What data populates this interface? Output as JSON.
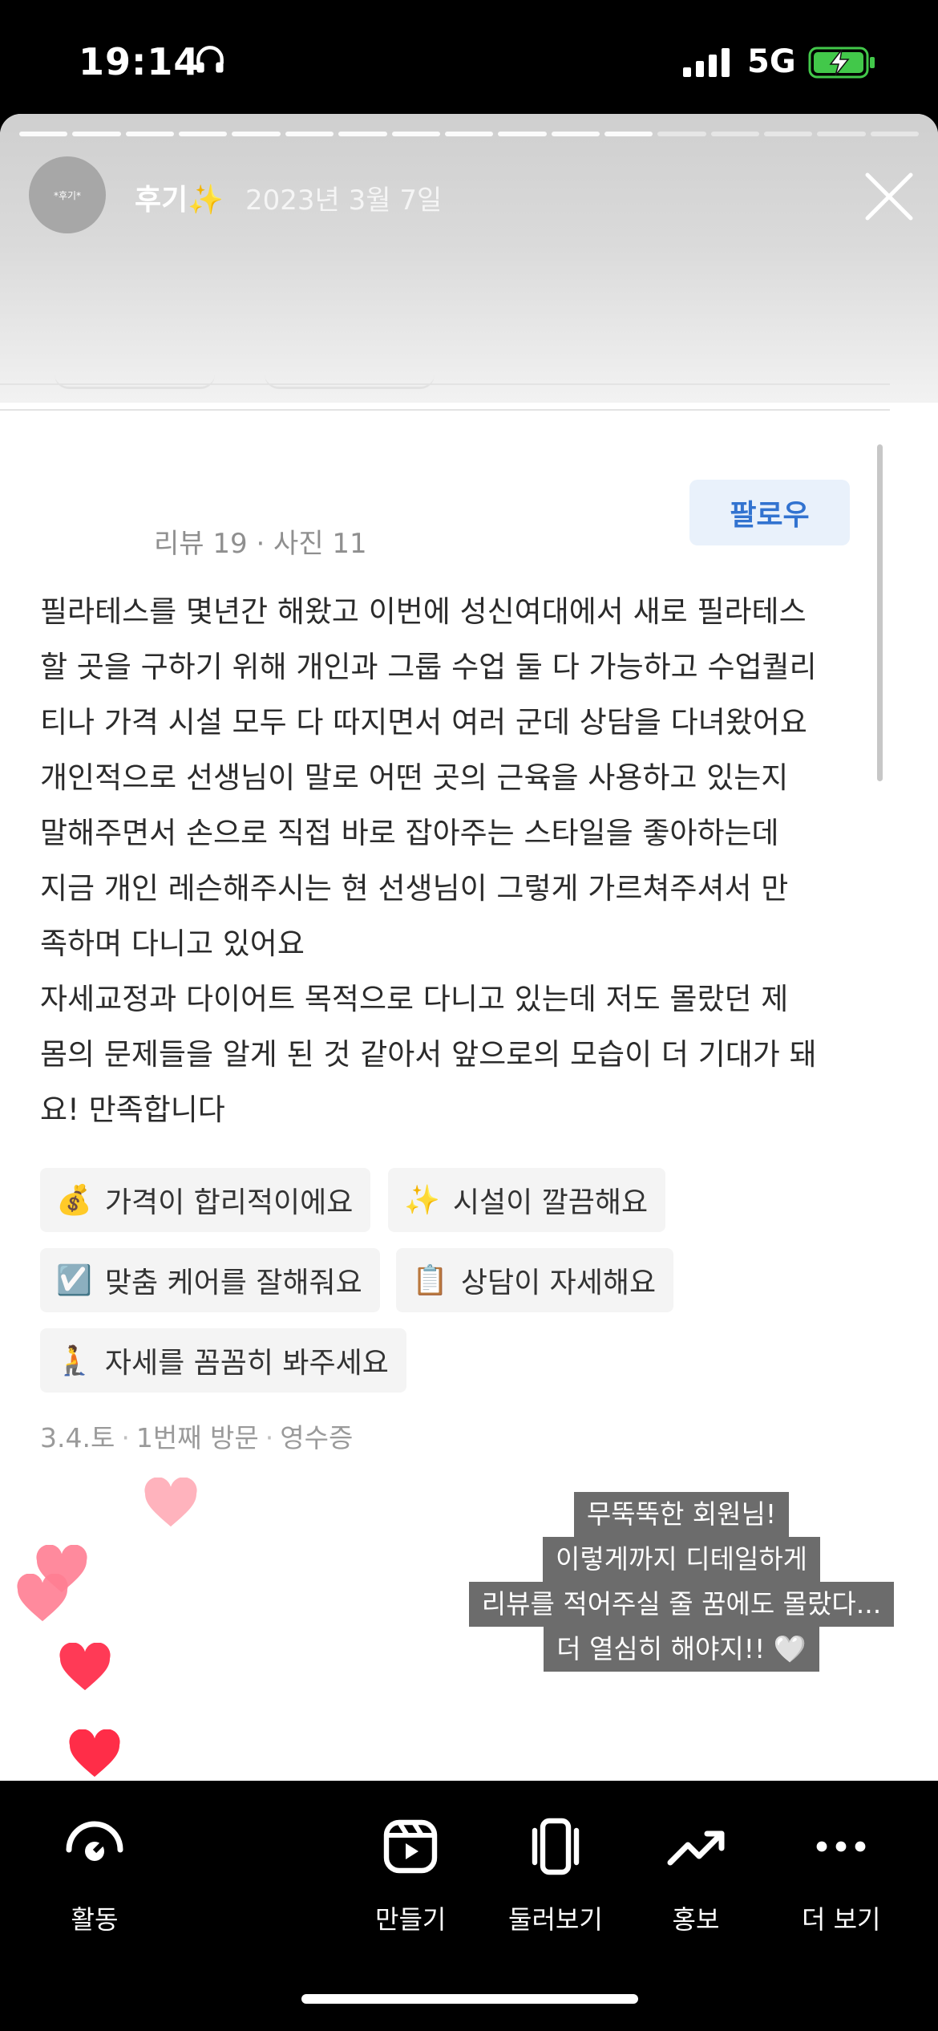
{
  "status_bar": {
    "time": "19:14",
    "network": "5G"
  },
  "story": {
    "avatar_text": "*후기*",
    "username": "후기✨",
    "date": "2023년 3월 7일"
  },
  "review": {
    "meta": "리뷰 19 · 사진 11",
    "follow_label": "팔로우",
    "lines": [
      "필라테스를 몇년간 해왔고 이번에 성신여대에서 새로 필라테스",
      "할 곳을 구하기 위해 개인과 그룹 수업 둘 다 가능하고 수업퀄리",
      "티나 가격 시설 모두 다 따지면서 여러 군데 상담을 다녀왔어요",
      "개인적으로 선생님이 말로 어떤 곳의 근육을 사용하고 있는지",
      "말해주면서 손으로 직접 바로 잡아주는 스타일을 좋아하는데",
      "지금 개인 레슨해주시는 현 선생님이 그렇게 가르쳐주셔서 만",
      "족하며 다니고 있어요",
      "자세교정과 다이어트 목적으로 다니고 있는데 저도 몰랐던 제",
      "몸의 문제들을 알게 된 것 같아서 앞으로의 모습이 더 기대가 돼",
      "요! 만족합니다"
    ],
    "tags": [
      {
        "icon": "💰",
        "label": "가격이 합리적이에요"
      },
      {
        "icon": "✨",
        "label": "시설이 깔끔해요"
      },
      {
        "icon": "☑️",
        "label": "맞춤 케어를 잘해줘요"
      },
      {
        "icon": "📋",
        "label": "상담이 자세해요"
      },
      {
        "icon": "🧎",
        "label": "자세를 꼼꼼히 봐주세요"
      }
    ],
    "footer": {
      "date": "3.4.토",
      "visit": "1번째 방문",
      "receipt": "영수증"
    }
  },
  "caption_lines": [
    "무뚝뚝한 회원님!",
    "이렇게까지 디테일하게",
    "리뷰를 적어주실 줄 꿈에도 몰랐다...",
    "더 열심히 해야지!! 🤍"
  ],
  "toolbar": {
    "activity": "활동",
    "create": "만들기",
    "browse": "둘러보기",
    "promote": "홍보",
    "more": "더 보기"
  },
  "colors": {
    "follow_text": "#3273d0",
    "follow_bg": "#e9f1fb",
    "caption_bg": "#6c6c6c",
    "heart_light": "#ffb3bd",
    "heart_mid": "#ff7d92",
    "heart_dark": "#ff2d48"
  }
}
